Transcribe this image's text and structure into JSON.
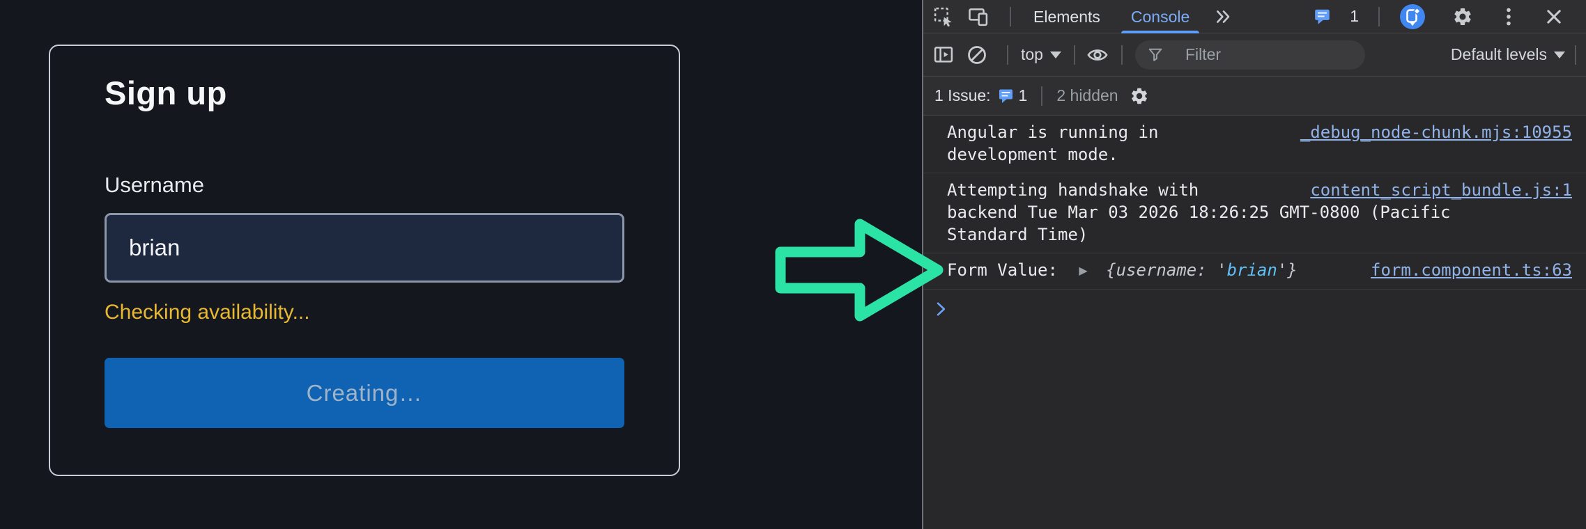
{
  "app": {
    "title": "Sign up",
    "username_label": "Username",
    "username_value": "brian",
    "status_text": "Checking availability...",
    "submit_label": "Creating…",
    "status_color": "#e9b832",
    "button_color": "#1063b2",
    "arrow_color": "#2ce3a6"
  },
  "devtools": {
    "tab_bar": {
      "elements_label": "Elements",
      "console_label": "Console",
      "issue_count": "1"
    },
    "toolbar": {
      "context_label": "top",
      "filter_placeholder": "Filter",
      "levels_label": "Default levels"
    },
    "issue_bar": {
      "issue_label": "1 Issue:",
      "issue_count": "1",
      "hidden_label": "2 hidden"
    },
    "console": {
      "messages": [
        {
          "text": "Angular is running in\ndevelopment mode.",
          "source": "_debug_node-chunk.mjs:10955"
        },
        {
          "text": "Attempting handshake with\nbackend Tue Mar 03 2026 18:26:25 GMT-0800 (Pacific\nStandard Time)",
          "source": "content_script_bundle.js:1"
        },
        {
          "label": "Form Value: ",
          "expander": "▶",
          "preview_open": "{",
          "preview_key": "username",
          "preview_sep": ": ",
          "preview_quote_open": "'",
          "preview_value": "brian",
          "preview_quote_close": "'",
          "preview_close": "}",
          "source": "form.component.ts:63"
        }
      ]
    },
    "accent_tab_color": "#7cacf8",
    "accent_link_color": "#91b3e8"
  }
}
